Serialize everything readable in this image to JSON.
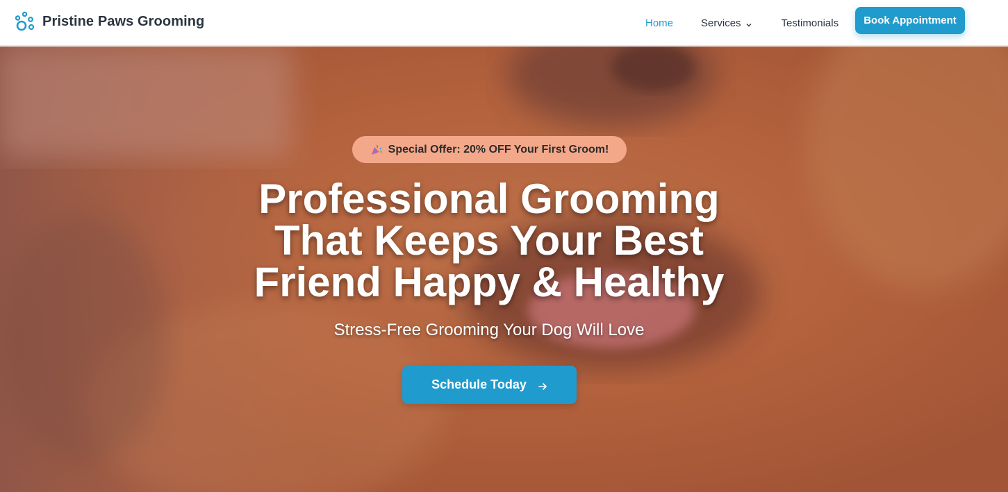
{
  "header": {
    "brand_name": "Pristine Paws Grooming",
    "brand_icon": "paw-icon",
    "nav": [
      {
        "label": "Home",
        "active": true
      },
      {
        "label": "Services",
        "has_dropdown": true
      },
      {
        "label": "Testimonials"
      }
    ],
    "book_button_label": "Book Appointment"
  },
  "hero": {
    "offer_icon": "party-popper-icon",
    "offer_text": "Special Offer: 20% OFF Your First Groom!",
    "title_lines": [
      "Professional Grooming",
      "That Keeps Your Best",
      "Friend Happy & Healthy"
    ],
    "subtitle": "Stress-Free Grooming Your Dog Will Love",
    "cta_label": "Schedule Today",
    "cta_icon": "arrow-right-icon"
  },
  "colors": {
    "accent": "#1f9bcd",
    "offer_pill": "#f4a88a",
    "text_dark": "#2b3440"
  }
}
